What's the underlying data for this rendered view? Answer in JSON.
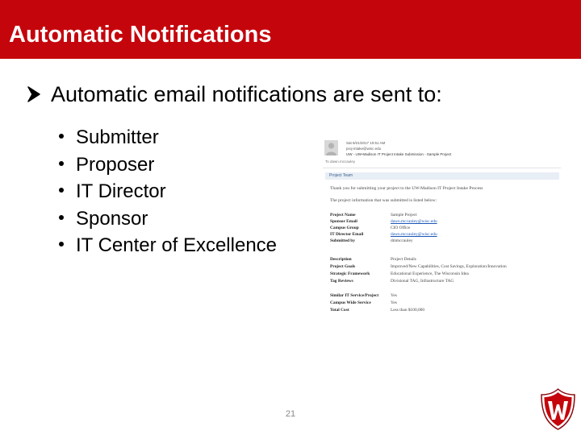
{
  "slide": {
    "title": "Automatic Notifications",
    "main_bullet": "Automatic email notifications are sent to:",
    "recipients": [
      "Submitter",
      "Proposer",
      "IT Director",
      "Sponsor",
      "IT Center of Excellence"
    ],
    "page_number": "21"
  },
  "email": {
    "date": "Sat 9/21/2017 10:51 AM",
    "from": "proj-intake@wisc.edu",
    "subject": "UW - UW-Madison IT Project Intake Submission - Sample Project",
    "to": "To    dawn.mccauley",
    "section_title": "Project Team",
    "intro": "Thank you for submitting your project to the UW-Madison IT Project Intake Process",
    "info_line": "The project information that was submitted is listed below:",
    "fields_group1": [
      {
        "label": "Project Name",
        "value": "Sample Project",
        "link": false
      },
      {
        "label": "Sponsor Email",
        "value": "dawn.mccauley@wisc.edu",
        "link": true
      },
      {
        "label": "Campus Group",
        "value": "CIO Office",
        "link": false
      },
      {
        "label": "IT Director Email",
        "value": "dawn.mccauley@wisc.edu",
        "link": true
      },
      {
        "label": "Submitted by",
        "value": "dmmccauley",
        "link": false
      }
    ],
    "fields_group2": [
      {
        "label": "Description",
        "value": "Project Details"
      },
      {
        "label": "Project Goals",
        "value": "Improved/New Capabilities, Cost Savings, Exploration/Innovation"
      },
      {
        "label": "Strategic Framework",
        "value": "Educational Experience, The Wisconsin Idea"
      },
      {
        "label": "Tag Reviews",
        "value": "Divisional TAG, Infrastructure TAG"
      }
    ],
    "fields_group3": [
      {
        "label": "Similar IT Service/Project",
        "value": "Yes"
      },
      {
        "label": "Campus Wide Service",
        "value": "Yes"
      },
      {
        "label": "Total Cost",
        "value": "Less than $100,000"
      }
    ]
  },
  "colors": {
    "header_red": "#c5050c",
    "text": "#000000",
    "link": "#1a55b8"
  }
}
